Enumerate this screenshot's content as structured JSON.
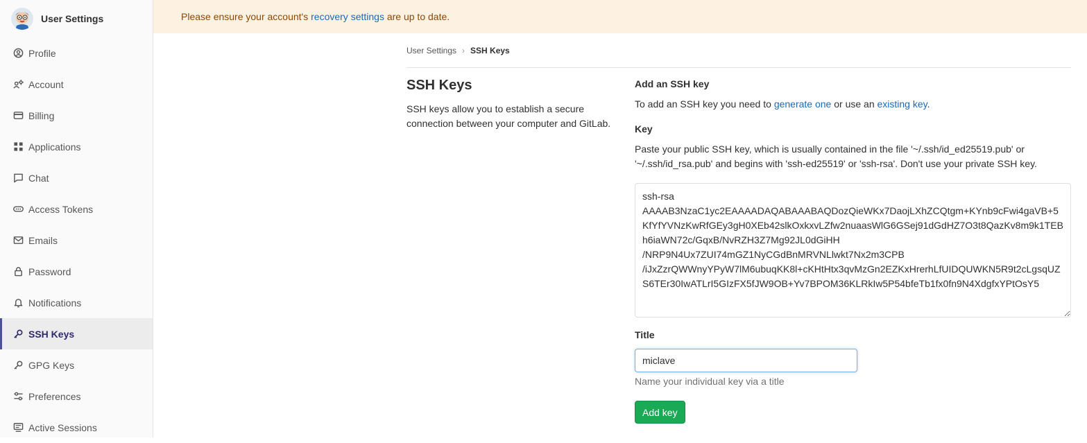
{
  "sidebar": {
    "title": "User Settings",
    "items": [
      {
        "label": "Profile",
        "icon": "profile-icon"
      },
      {
        "label": "Account",
        "icon": "account-icon"
      },
      {
        "label": "Billing",
        "icon": "billing-icon"
      },
      {
        "label": "Applications",
        "icon": "applications-icon"
      },
      {
        "label": "Chat",
        "icon": "chat-icon"
      },
      {
        "label": "Access Tokens",
        "icon": "token-icon"
      },
      {
        "label": "Emails",
        "icon": "mail-icon"
      },
      {
        "label": "Password",
        "icon": "lock-icon"
      },
      {
        "label": "Notifications",
        "icon": "bell-icon"
      },
      {
        "label": "SSH Keys",
        "icon": "key-icon",
        "active": true
      },
      {
        "label": "GPG Keys",
        "icon": "key-icon"
      },
      {
        "label": "Preferences",
        "icon": "preferences-icon"
      },
      {
        "label": "Active Sessions",
        "icon": "sessions-icon"
      }
    ]
  },
  "alert": {
    "prefix": "Please ensure your account's ",
    "link": "recovery settings",
    "suffix": " are up to date."
  },
  "breadcrumb": {
    "parent": "User Settings",
    "current": "SSH Keys"
  },
  "section": {
    "title": "SSH Keys",
    "description": "SSH keys allow you to establish a secure connection between your computer and GitLab."
  },
  "form": {
    "heading": "Add an SSH key",
    "intro_prefix": "To add an SSH key you need to ",
    "intro_link1": "generate one",
    "intro_middle": " or use an ",
    "intro_link2": "existing key",
    "intro_suffix": ".",
    "key_label": "Key",
    "key_help": "Paste your public SSH key, which is usually contained in the file '~/.ssh/id_ed25519.pub' or '~/.ssh/id_rsa.pub' and begins with 'ssh-ed25519' or 'ssh-rsa'. Don't use your private SSH key.",
    "key_value": "ssh-rsa\nAAAAB3NzaC1yc2EAAAADAQABAAABAQDozQieWKx7DaojLXhZCQtgm+KYnb9cFwi4gaVB+5KfYfYVNzKwRfGEy3gH0XEb42slkOxkxvLZfw2nuaasWlG6GSej91dGdHZ7O3t8QazKv8m9k1TEBh6iaWN72c/GqxB/NvRZH3Z7Mg92JL0dGiHH\n/NRP9N4Ux7ZUI74mGZ1NyCGdBnMRVNLlwkt7Nx2m3CPB\n/iJxZzrQWWnyYPyW7lM6ubuqKK8l+cKHtHtx3qvMzGn2EZKxHrerhLfUIDQUWKN5R9t2cLgsqUZS6TEr30IwATLrI5GIzFX5fJW9OB+Yv7BPOM36KLRkIw5P54bfeTb1fx0fn9N4XdgfxYPtOsY5",
    "title_label": "Title",
    "title_value": "miclave",
    "title_hint": "Name your individual key via a title",
    "submit_label": "Add key"
  },
  "colors": {
    "accent": "#1b69b6",
    "alert_bg": "#fdf1e2",
    "alert_text": "#8f4700",
    "success": "#1aaa55",
    "active_nav": "#4e4f97"
  }
}
